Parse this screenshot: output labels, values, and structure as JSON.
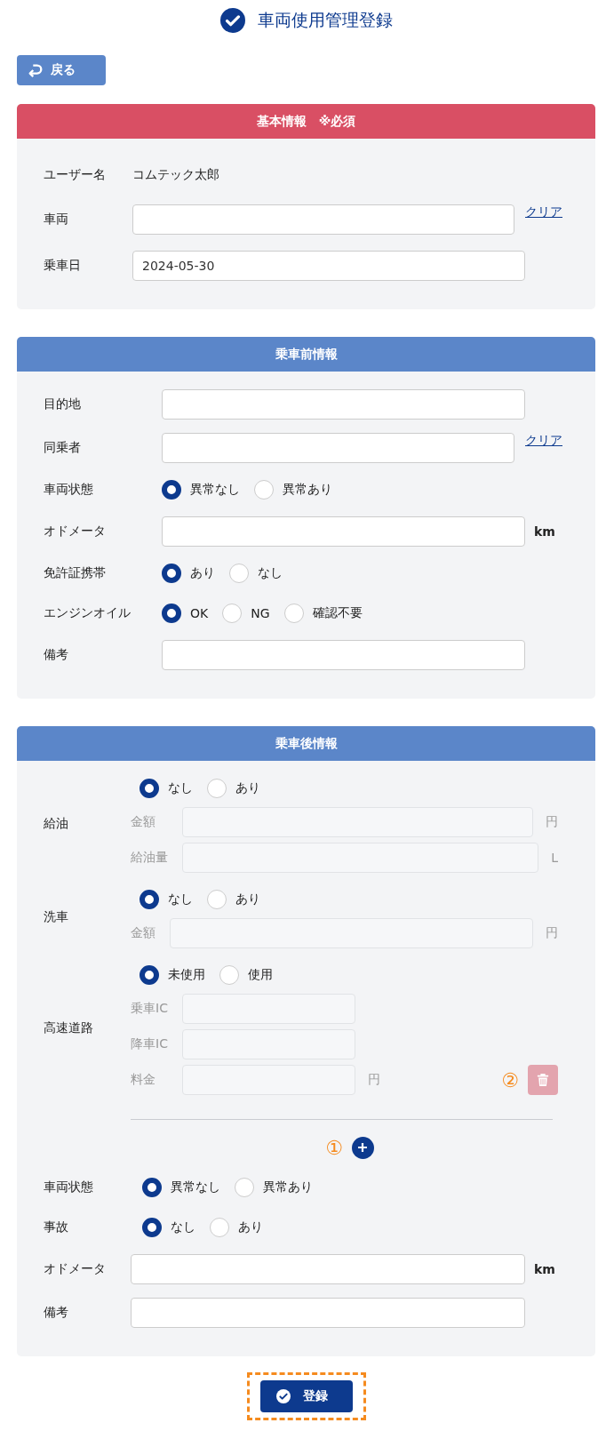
{
  "title": "車両使用管理登録",
  "back_button": {
    "label": "戻る"
  },
  "sections": [
    {
      "title": "基本情報　※必須",
      "kind": "required",
      "rows": [
        {
          "kind": "text",
          "label": "ユーザー名",
          "value": "コムテック太郎"
        },
        {
          "kind": "input",
          "label": "車両",
          "link": "クリア"
        },
        {
          "kind": "input",
          "label": "乗車日",
          "value": "2024-05-30"
        }
      ]
    },
    {
      "title": "乗車前情報",
      "kind": "normal",
      "rows": [
        {
          "kind": "input",
          "label": "目的地"
        },
        {
          "kind": "input",
          "label": "同乗者",
          "link": "クリア"
        },
        {
          "kind": "radio",
          "label": "車両状態",
          "options": [
            {
              "label": "異常なし",
              "selected": true
            },
            {
              "label": "異常あり",
              "selected": false
            }
          ]
        },
        {
          "kind": "input",
          "label": "オドメータ",
          "unit": "km"
        },
        {
          "kind": "radio",
          "label": "免許証携帯",
          "options": [
            {
              "label": "あり",
              "selected": true
            },
            {
              "label": "なし",
              "selected": false
            }
          ]
        },
        {
          "kind": "radio",
          "label": "エンジンオイル",
          "options": [
            {
              "label": "OK",
              "selected": true
            },
            {
              "label": "NG",
              "selected": false
            },
            {
              "label": "確認不要",
              "selected": false
            }
          ]
        },
        {
          "kind": "input",
          "label": "備考"
        }
      ]
    },
    {
      "title": "乗車後情報",
      "kind": "normal",
      "rows": [
        {
          "kind": "group",
          "label": "給油",
          "items": [
            {
              "kind": "radio",
              "options": [
                {
                  "label": "なし",
                  "selected": true
                },
                {
                  "label": "あり",
                  "selected": false
                }
              ]
            },
            {
              "kind": "input",
              "label": "金額",
              "unit": "円",
              "disabled": true
            },
            {
              "kind": "input",
              "label": "給油量",
              "unit": "L",
              "disabled": true
            }
          ]
        },
        {
          "kind": "group",
          "label": "洗車",
          "items": [
            {
              "kind": "radio",
              "options": [
                {
                  "label": "なし",
                  "selected": true
                },
                {
                  "label": "あり",
                  "selected": false
                }
              ]
            },
            {
              "kind": "input",
              "label": "金額",
              "unit": "円",
              "disabled": true
            }
          ]
        },
        {
          "kind": "group",
          "label": "高速道路",
          "items": [
            {
              "kind": "radio",
              "options": [
                {
                  "label": "未使用",
                  "selected": true
                },
                {
                  "label": "使用",
                  "selected": false
                }
              ]
            },
            {
              "kind": "short",
              "label": "乗車IC",
              "disabled": true
            },
            {
              "kind": "short",
              "label": "降車IC",
              "disabled": true
            },
            {
              "kind": "short",
              "label": "料金",
              "unit": "円",
              "disabled": true,
              "marker": "②",
              "delete_disabled": true
            }
          ]
        },
        {
          "kind": "divider"
        },
        {
          "kind": "add",
          "marker": "①"
        },
        {
          "kind": "radio",
          "label": "車両状態",
          "options": [
            {
              "label": "異常なし",
              "selected": true
            },
            {
              "label": "異常あり",
              "selected": false
            }
          ]
        },
        {
          "kind": "radio",
          "label": "事故",
          "options": [
            {
              "label": "なし",
              "selected": true
            },
            {
              "label": "あり",
              "selected": false
            }
          ]
        },
        {
          "kind": "input",
          "label": "オドメータ",
          "unit": "km"
        },
        {
          "kind": "input",
          "label": "備考"
        }
      ]
    }
  ],
  "submit_button": {
    "label": "登録",
    "highlighted": true
  }
}
